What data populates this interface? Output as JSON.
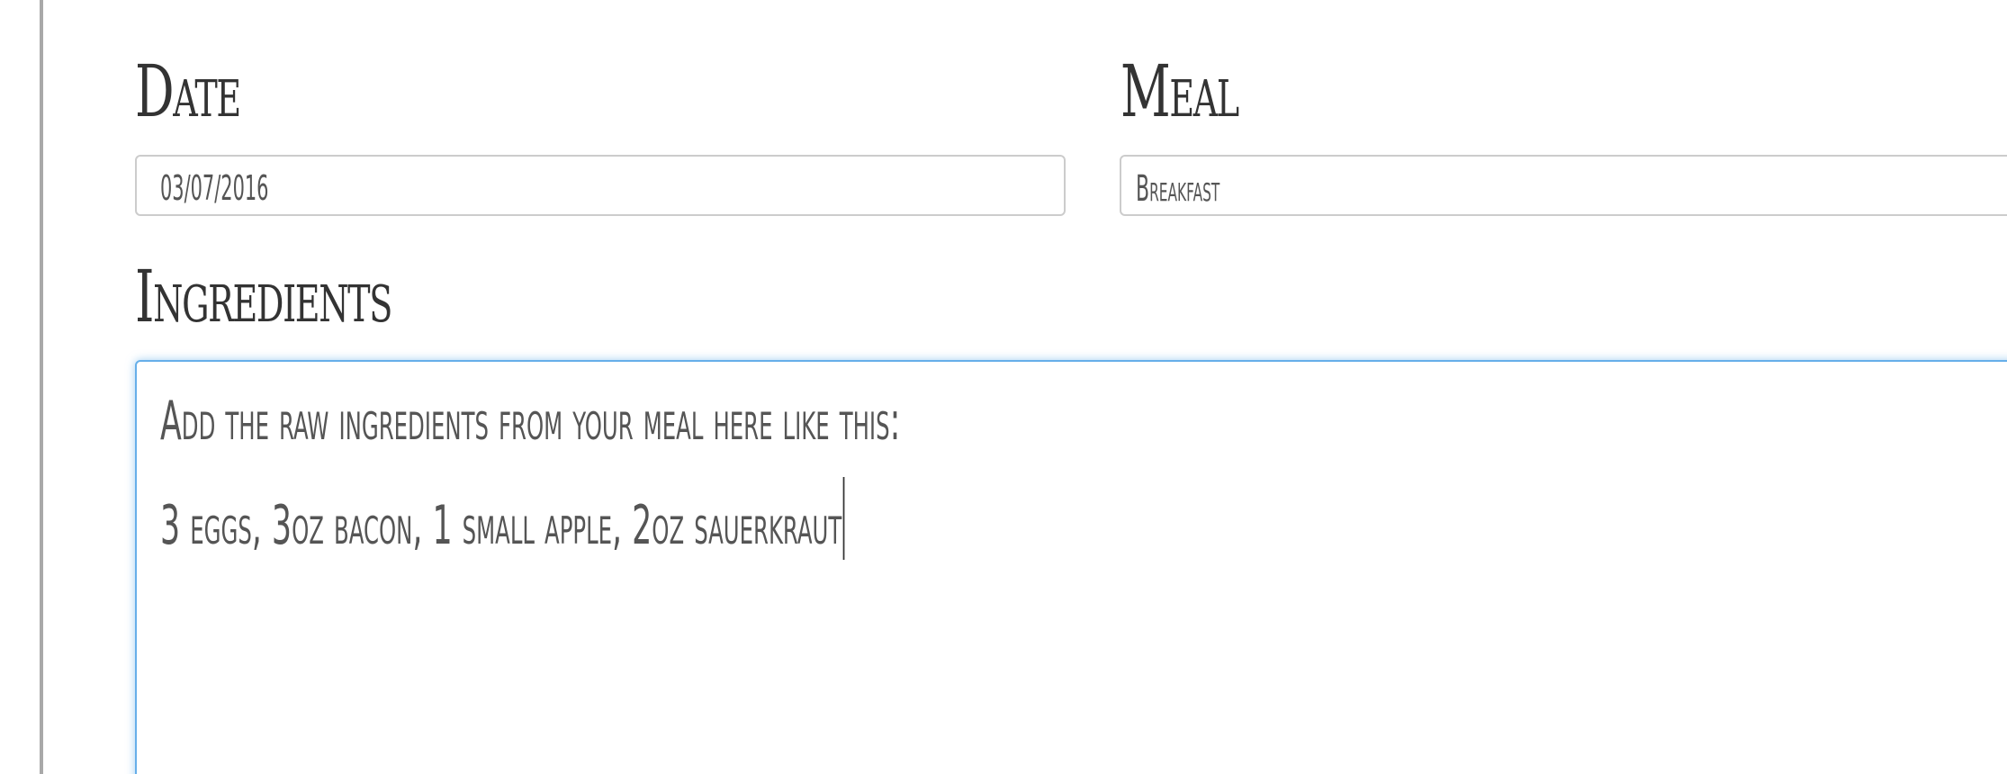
{
  "form": {
    "date": {
      "label": "Date",
      "value": "03/07/2016"
    },
    "meal": {
      "label": "Meal",
      "value": "Breakfast"
    },
    "ingredients": {
      "label": "Ingredients",
      "lines": [
        "Add the raw ingredients from your meal here like this:",
        "3 eggs, 3oz bacon, 1 small apple, 2oz sauerkraut"
      ]
    }
  },
  "colors": {
    "focus_border": "#66afe9",
    "input_border": "#cccccc",
    "text": "#333333"
  }
}
